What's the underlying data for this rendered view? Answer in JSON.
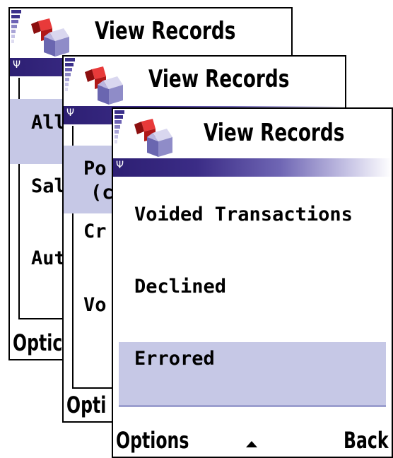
{
  "screens": [
    {
      "title": "View Records",
      "rows": [
        "All",
        "Sal",
        "Aut"
      ],
      "softkey_left": "Optic"
    },
    {
      "title": "View Records",
      "rows": [
        "Po",
        "(c",
        "Cr",
        "Vo"
      ],
      "softkey_left": "Opti"
    },
    {
      "title": "View Records",
      "rows": [
        "Voided Transactions",
        "Declined",
        "Errored"
      ],
      "selected_row": "Errored",
      "softkey_left": "Options",
      "softkey_right": "Back",
      "softkey_center_icon": "up-arrow-icon"
    }
  ],
  "colors": {
    "band_dark": "#2d1f73",
    "selection": "#c6c8e6"
  },
  "icons": {
    "signal": "signal-strength-icon",
    "app": "records-cubes-icon",
    "antenna": "antenna-icon"
  }
}
